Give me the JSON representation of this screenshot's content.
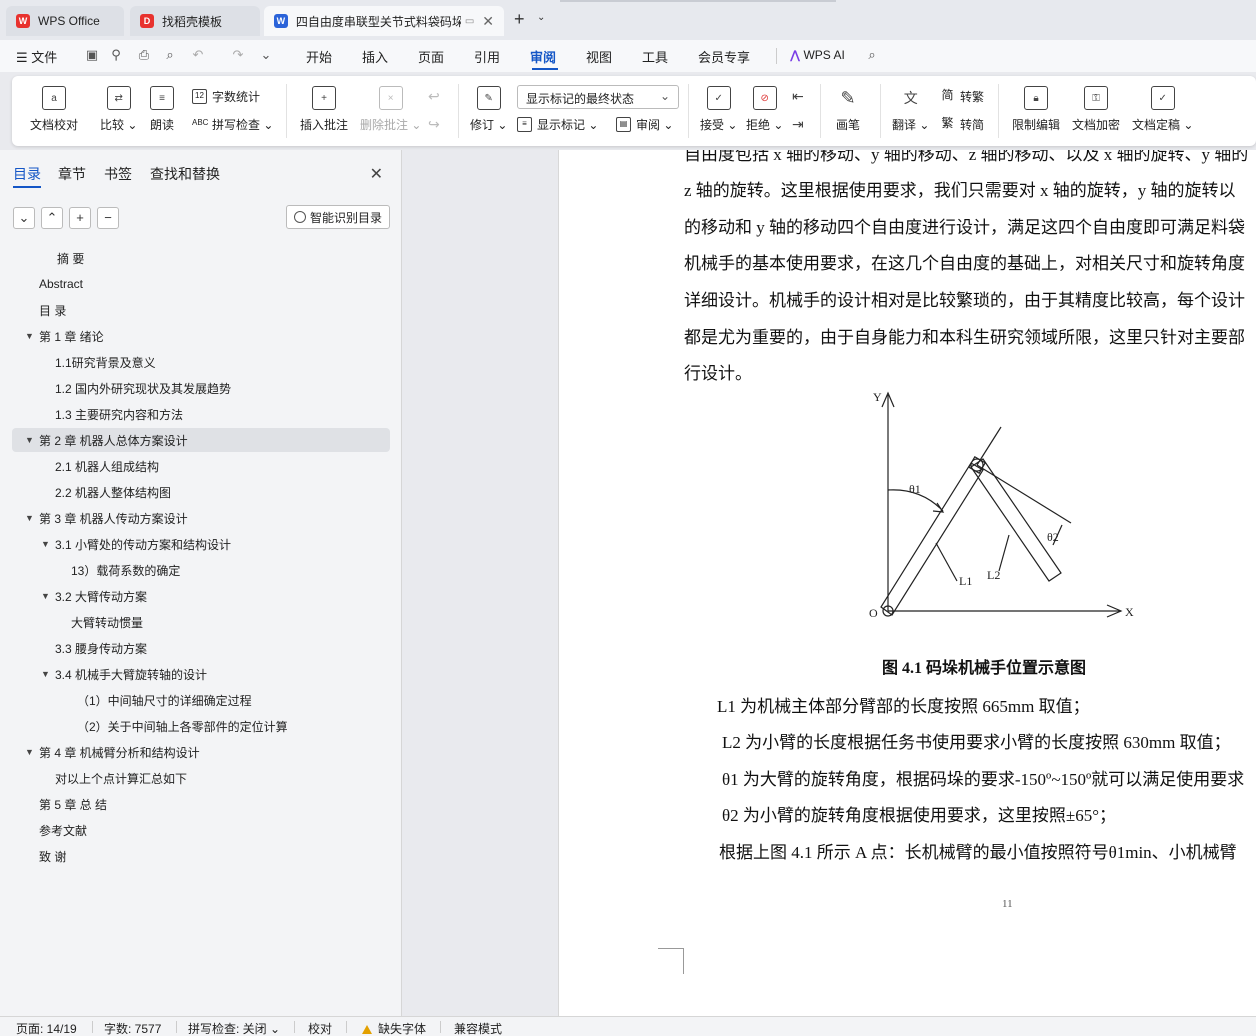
{
  "tabs": [
    {
      "label": "WPS Office",
      "icon": "wps-logo-icon"
    },
    {
      "label": "找稻壳模板",
      "icon": "docer-icon"
    },
    {
      "label": "四自由度串联型关节式料袋码垛",
      "icon": "word-doc-icon"
    }
  ],
  "menu": {
    "file": "文件",
    "items": [
      "开始",
      "插入",
      "页面",
      "引用",
      "审阅",
      "视图",
      "工具",
      "会员专享"
    ],
    "active": "审阅",
    "ai": "WPS AI"
  },
  "ribbon": {
    "doc_check": "文档校对",
    "compare": "比较",
    "read_aloud": "朗读",
    "word_count": "字数统计",
    "spell_check": "拼写检查",
    "insert_comment": "插入批注",
    "delete_comment": "删除批注",
    "track_changes": "修订",
    "markup_state": "显示标记的最终状态",
    "show_markup": "显示标记",
    "review": "审阅",
    "accept": "接受",
    "reject": "拒绝",
    "pen": "画笔",
    "translate": "翻译",
    "to_traditional": "转繁",
    "to_simplified": "转简",
    "restrict_edit": "限制编辑",
    "encrypt": "文档加密",
    "finalize": "文档定稿"
  },
  "sidebar": {
    "tabs": [
      "目录",
      "章节",
      "书签",
      "查找和替换"
    ],
    "smart_toc": "智能识别目录",
    "toc": [
      {
        "text": "摘  要",
        "level": 1,
        "arrow": false
      },
      {
        "text": "Abstract",
        "level": 1,
        "arrow": false
      },
      {
        "text": "目  录",
        "level": 1,
        "arrow": false
      },
      {
        "text": "第 1 章   绪论",
        "level": 1,
        "arrow": true
      },
      {
        "text": "1.1研究背景及意义",
        "level": 2,
        "arrow": false
      },
      {
        "text": "1.2  国内外研究现状及其发展趋势",
        "level": 2,
        "arrow": false
      },
      {
        "text": "1.3  主要研究内容和方法",
        "level": 2,
        "arrow": false
      },
      {
        "text": "第 2 章   机器人总体方案设计",
        "level": 1,
        "arrow": true,
        "selected": true
      },
      {
        "text": "2.1 机器人组成结构",
        "level": 2,
        "arrow": false
      },
      {
        "text": "2.2 机器人整体结构图",
        "level": 2,
        "arrow": false
      },
      {
        "text": "第 3 章  机器人传动方案设计",
        "level": 1,
        "arrow": true
      },
      {
        "text": "3.1 小臂处的传动方案和结构设计",
        "level": 2,
        "arrow": true
      },
      {
        "text": "13）载荷系数的确定",
        "level": 3,
        "arrow": false
      },
      {
        "text": "3.2 大臂传动方案",
        "level": 2,
        "arrow": true
      },
      {
        "text": "大臂转动惯量",
        "level": 3,
        "arrow": false
      },
      {
        "text": "3.3 腰身传动方案",
        "level": 2,
        "arrow": false
      },
      {
        "text": "3.4 机械手大臂旋转轴的设计",
        "level": 2,
        "arrow": true
      },
      {
        "text": "（1）中间轴尺寸的详细确定过程",
        "level": 4,
        "arrow": false
      },
      {
        "text": "（2）关于中间轴上各零部件的定位计算",
        "level": 4,
        "arrow": false
      },
      {
        "text": "第 4 章  机械臂分析和结构设计",
        "level": 1,
        "arrow": true
      },
      {
        "text": "对以上个点计算汇总如下",
        "level": 2,
        "arrow": false
      },
      {
        "text": "第 5 章  总  结",
        "level": 1,
        "arrow": false
      },
      {
        "text": "参考文献",
        "level": 1,
        "arrow": false
      },
      {
        "text": "致  谢",
        "level": 1,
        "arrow": false
      }
    ]
  },
  "document": {
    "lines": [
      "自由度包括 x 轴的移动、y 轴的移动、z 轴的移动、以及 x 轴的旋转、y 轴的",
      "z 轴的旋转。这里根据使用要求，我们只需要对 x 轴的旋转，y 轴的旋转以",
      "的移动和 y 轴的移动四个自由度进行设计，满足这四个自由度即可满足料袋",
      "机械手的基本使用要求，在这几个自由度的基础上，对相关尺寸和旋转角度",
      "详细设计。机械手的设计相对是比较繁琐的，由于其精度比较高，每个设计",
      "都是尤为重要的，由于自身能力和本科生研究领域所限，这里只针对主要部",
      "行设计。"
    ],
    "figure": {
      "y_axis": "Y",
      "x_axis": "X",
      "origin": "O",
      "theta1": "θ1",
      "theta2": "θ2",
      "l1": "L1",
      "l2": "L2"
    },
    "caption": "图 4.1  码垛机械手位置示意图",
    "after_lines": [
      "L1 为机械主体部分臂部的长度按照 665mm 取值；",
      "L2 为小臂的长度根据任务书使用要求小臂的长度按照 630mm 取值；",
      "θ1 为大臂的旋转角度，根据码垛的要求-150º~150º就可以满足使用要求",
      "θ2 为小臂的旋转角度根据使用要求，这里按照±65°；",
      "根据上图 4.1 所示 A 点：长机械臂的最小值按照符号θ1min、小机械臂"
    ],
    "page_number": "11"
  },
  "status": {
    "page": "页面: 14/19",
    "words": "字数: 7577",
    "spell": "拼写检查: 关闭",
    "proof": "校对",
    "missing_font": "缺失字体",
    "compat": "兼容模式"
  },
  "colors": {
    "accent": "#1456c6",
    "wps_red": "#e8322e"
  }
}
